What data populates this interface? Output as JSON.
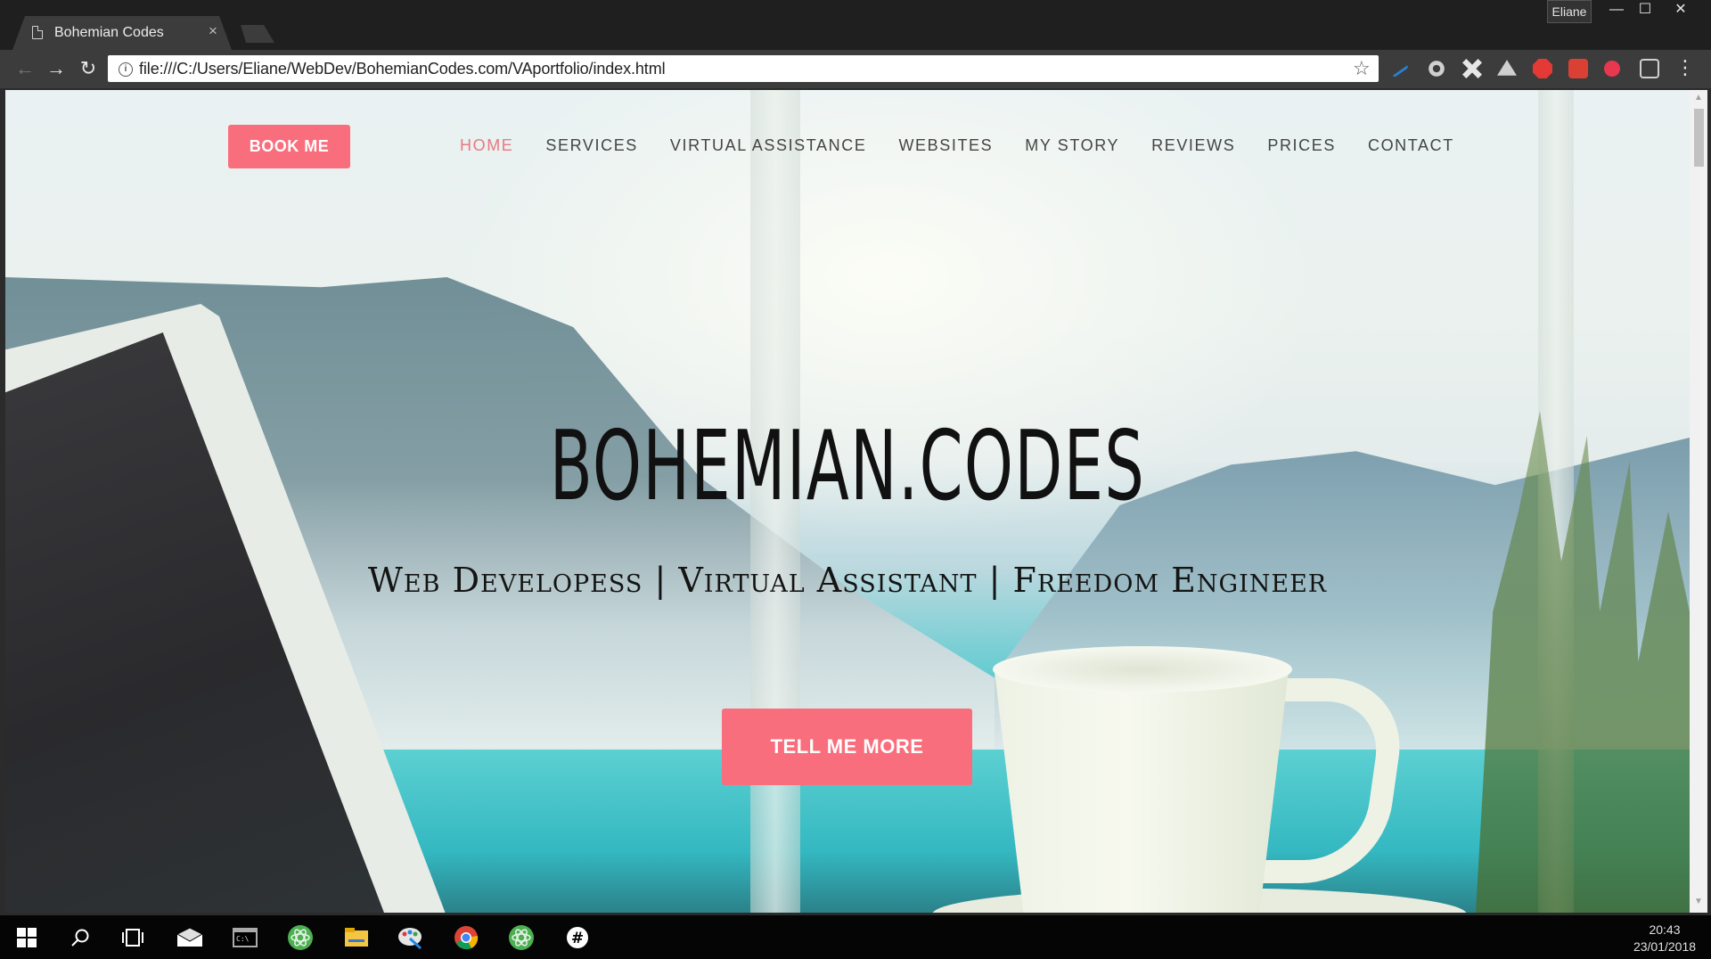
{
  "browser": {
    "tab_title": "Bohemian Codes",
    "tab_close": "×",
    "user": "Eliane",
    "window_controls": {
      "minimize": "—",
      "maximize": "☐",
      "close": "✕"
    },
    "url": "file:///C:/Users/Eliane/WebDev/BohemianCodes.com/VAportfolio/index.html",
    "nav": {
      "back": "←",
      "forward": "→",
      "reload": "↻"
    },
    "star": "☆",
    "menu": "⋮",
    "extensions": [
      {
        "icon": "pen-extension-icon",
        "color": "#2a7fd4"
      },
      {
        "icon": "gear-extension-icon",
        "color": "#cfcfcf"
      },
      {
        "icon": "puzzle-extension-icon",
        "color": "#e6e6e6"
      },
      {
        "icon": "drive-extension-icon",
        "color": "#cfcfcf"
      },
      {
        "icon": "adblock-extension-icon",
        "color": "#e53935"
      },
      {
        "icon": "todoist-extension-icon",
        "color": "#db4035"
      },
      {
        "icon": "t-extension-icon",
        "color": "#e8384f"
      },
      {
        "icon": "screenshot-extension-icon",
        "color": "#d0d0d0"
      }
    ]
  },
  "page": {
    "book_button": "BOOK ME",
    "nav_items": [
      "HOME",
      "SERVICES",
      "VIRTUAL ASSISTANCE",
      "WEBSITES",
      "MY STORY",
      "REVIEWS",
      "PRICES",
      "CONTACT"
    ],
    "active_nav": "HOME",
    "hero_title": "BOHEMIAN.CODES",
    "hero_subtitle": "Web Developess | Virtual Assistant | Freedom Engineer",
    "cta_button": "TELL ME MORE",
    "accent_color": "#f96e7c"
  },
  "taskbar": {
    "icons": [
      "windows-start-icon",
      "search-icon",
      "task-view-icon",
      "mail-icon",
      "terminal-icon",
      "atom-icon",
      "file-explorer-icon",
      "paint-icon",
      "chrome-icon",
      "atom-icon",
      "slack-icon"
    ],
    "time": "20:43",
    "date": "23/01/2018"
  }
}
